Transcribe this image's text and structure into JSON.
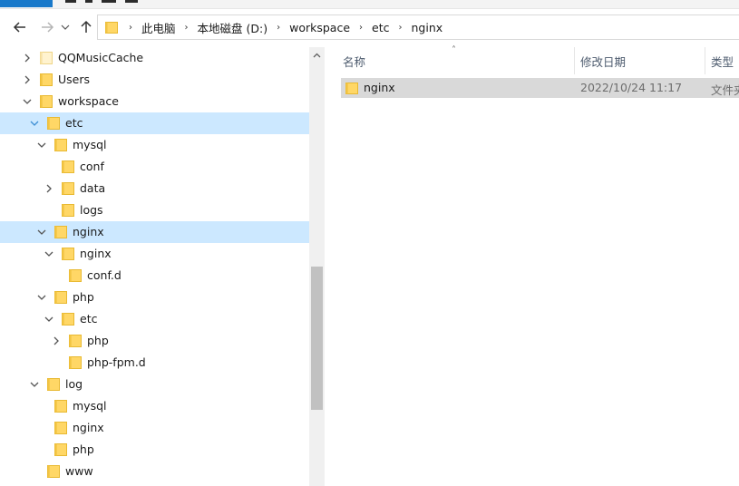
{
  "address_bar": {
    "crumbs": [
      "此电脑",
      "本地磁盘 (D:)",
      "workspace",
      "etc",
      "nginx"
    ]
  },
  "nav": {
    "back_icon": "arrow-left-icon",
    "forward_icon": "arrow-right-icon",
    "history_icon": "chevron-down-icon",
    "up_icon": "arrow-up-icon"
  },
  "tree": {
    "items": [
      {
        "label": "QQMusicCache",
        "expander": "collapsed"
      },
      {
        "label": "Users",
        "expander": "collapsed"
      },
      {
        "label": "workspace",
        "expander": "expanded"
      },
      {
        "label": "etc",
        "expander": "expanded",
        "state": "current"
      },
      {
        "label": "mysql",
        "expander": "expanded"
      },
      {
        "label": "conf",
        "expander": "none"
      },
      {
        "label": "data",
        "expander": "collapsed"
      },
      {
        "label": "logs",
        "expander": "none"
      },
      {
        "label": "nginx",
        "expander": "expanded",
        "state": "selected"
      },
      {
        "label": "nginx",
        "expander": "expanded"
      },
      {
        "label": "conf.d",
        "expander": "none"
      },
      {
        "label": "php",
        "expander": "expanded"
      },
      {
        "label": "etc",
        "expander": "expanded"
      },
      {
        "label": "php",
        "expander": "collapsed"
      },
      {
        "label": "php-fpm.d",
        "expander": "none"
      },
      {
        "label": "log",
        "expander": "expanded"
      },
      {
        "label": "mysql",
        "expander": "none"
      },
      {
        "label": "nginx",
        "expander": "none"
      },
      {
        "label": "php",
        "expander": "none"
      },
      {
        "label": "www",
        "expander": "none"
      }
    ]
  },
  "columns": {
    "name": "名称",
    "date": "修改日期",
    "type": "类型"
  },
  "files": [
    {
      "name": "nginx",
      "date": "2022/10/24 11:17",
      "type": "文件夹"
    }
  ],
  "colors": {
    "selection": "#cce8ff",
    "folder_fill": "#ffd766",
    "folder_edge": "#e8b932",
    "file_row_highlight": "#d9d9d9"
  }
}
